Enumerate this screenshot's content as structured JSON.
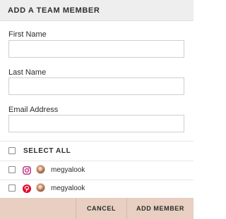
{
  "dialog": {
    "title": "ADD A TEAM MEMBER"
  },
  "form": {
    "first_name": {
      "label": "First Name",
      "value": ""
    },
    "last_name": {
      "label": "Last Name",
      "value": ""
    },
    "email": {
      "label": "Email Address",
      "value": ""
    }
  },
  "select_all": {
    "label": "SELECT ALL",
    "checked": false
  },
  "accounts": [
    {
      "network": "instagram-icon",
      "username": "megyalook",
      "checked": false
    },
    {
      "network": "pinterest-icon",
      "username": "megyalook",
      "checked": false
    }
  ],
  "footer": {
    "cancel_label": "CANCEL",
    "add_label": "ADD MEMBER"
  },
  "colors": {
    "header_bg": "#eeeeee",
    "footer_bg": "#e8cfc2",
    "instagram": "#c13584",
    "pinterest": "#e60023"
  }
}
